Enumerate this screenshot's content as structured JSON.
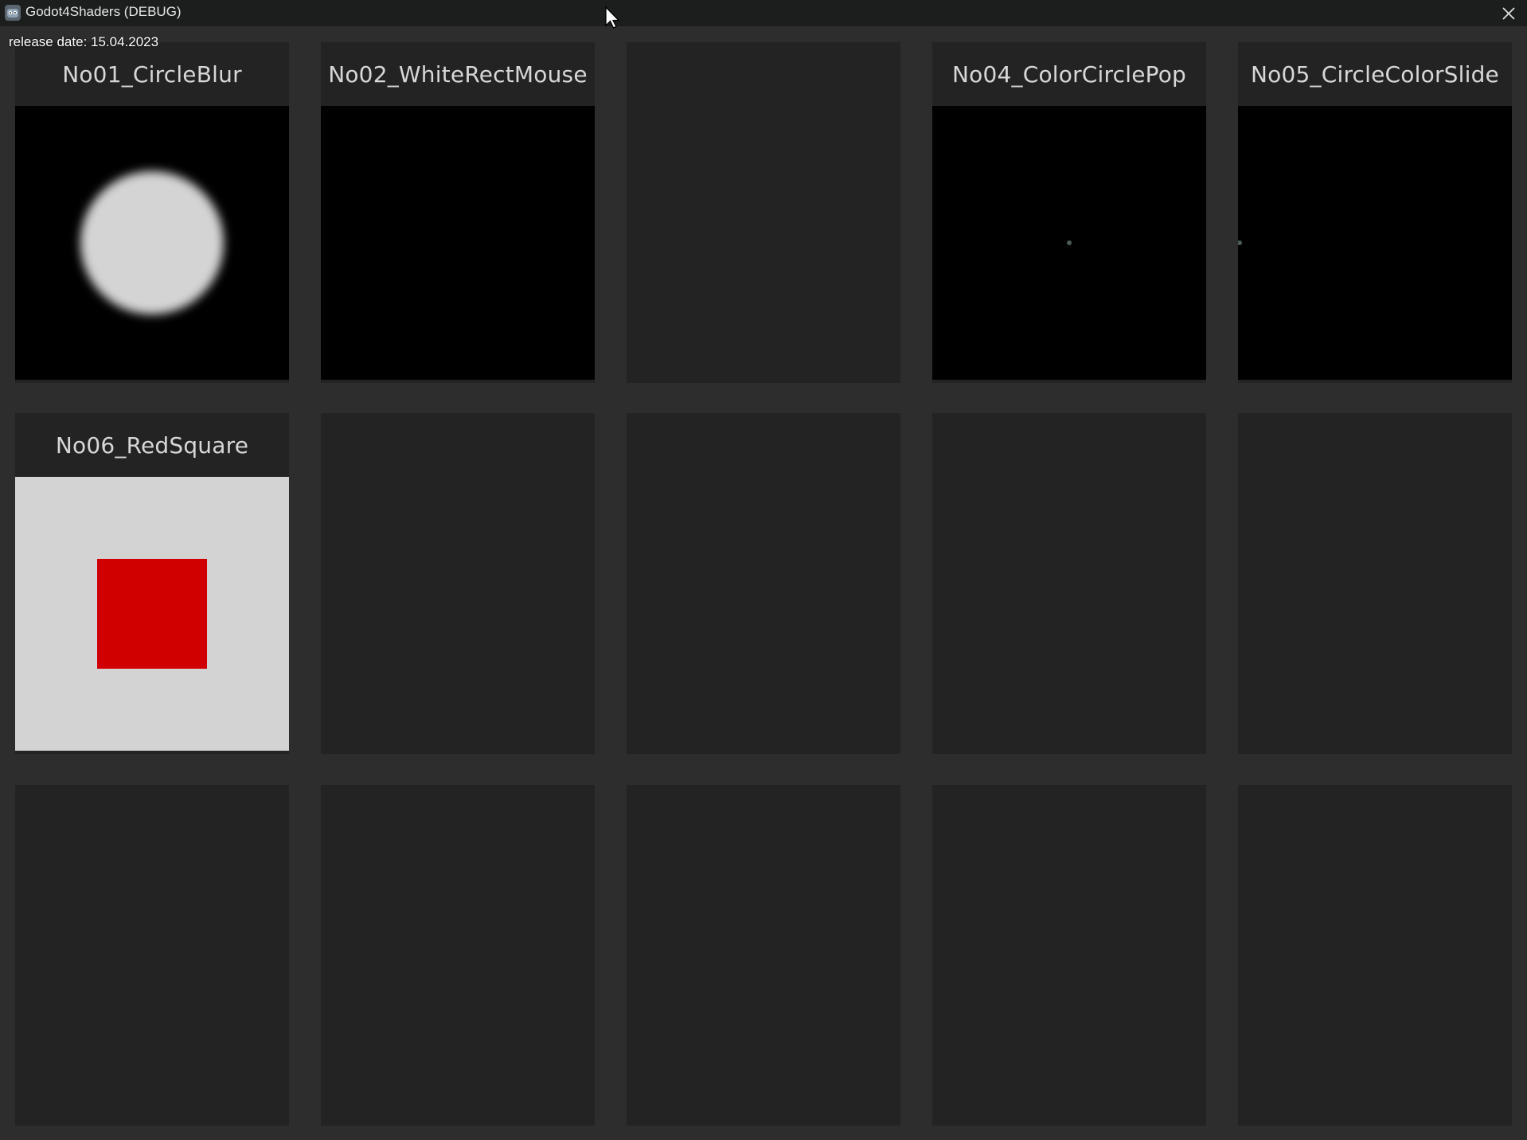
{
  "window": {
    "title": "Godot4Shaders (DEBUG)",
    "app_icon": "godot-icon",
    "close_icon": "close-icon"
  },
  "release_label": "release date: 15.04.2023",
  "colors": {
    "background": "#2d2d2d",
    "cell": "#232323",
    "title_text": "#d7d7d7",
    "red_square": "#d00000",
    "light_preview": "#d3d3d3"
  },
  "cells": [
    {
      "title": "No01_CircleBlur"
    },
    {
      "title": "No02_WhiteRectMouse"
    },
    {
      "title": ""
    },
    {
      "title": "No04_ColorCirclePop"
    },
    {
      "title": "No05_CircleColorSlide"
    },
    {
      "title": "No06_RedSquare"
    }
  ]
}
